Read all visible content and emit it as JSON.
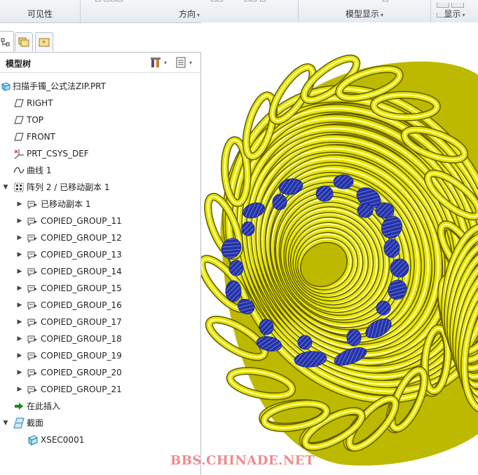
{
  "ribbon": {
    "groups": [
      {
        "label": "可见性"
      },
      {
        "label": "方向"
      },
      {
        "label": "模型显示"
      },
      {
        "label": "显示"
      }
    ],
    "caret": "▾"
  },
  "tree": {
    "title": "模型树",
    "root": "扫描手镯_公式法ZIP.PRT",
    "items": [
      {
        "label": "RIGHT",
        "icon": "datum-plane-icon"
      },
      {
        "label": "TOP",
        "icon": "datum-plane-icon"
      },
      {
        "label": "FRONT",
        "icon": "datum-plane-icon"
      },
      {
        "label": "PRT_CSYS_DEF",
        "icon": "coordinate-system-icon"
      },
      {
        "label": "曲线 1",
        "icon": "curve-icon"
      },
      {
        "label": "阵列 2 / 已移动副本 1",
        "icon": "pattern-icon"
      },
      {
        "label": "已移动副本 1",
        "icon": "group-icon"
      },
      {
        "label": "COPIED_GROUP_11",
        "icon": "group-icon"
      },
      {
        "label": "COPIED_GROUP_12",
        "icon": "group-icon"
      },
      {
        "label": "COPIED_GROUP_13",
        "icon": "group-icon"
      },
      {
        "label": "COPIED_GROUP_14",
        "icon": "group-icon"
      },
      {
        "label": "COPIED_GROUP_15",
        "icon": "group-icon"
      },
      {
        "label": "COPIED_GROUP_16",
        "icon": "group-icon"
      },
      {
        "label": "COPIED_GROUP_17",
        "icon": "group-icon"
      },
      {
        "label": "COPIED_GROUP_18",
        "icon": "group-icon"
      },
      {
        "label": "COPIED_GROUP_19",
        "icon": "group-icon"
      },
      {
        "label": "COPIED_GROUP_20",
        "icon": "group-icon"
      },
      {
        "label": "COPIED_GROUP_21",
        "icon": "group-icon"
      },
      {
        "label": "在此插入",
        "icon": "insert-here-icon"
      },
      {
        "label": "截面",
        "icon": "cross-section-icon"
      },
      {
        "label": "XSEC0001",
        "icon": "xsec-icon"
      }
    ]
  },
  "watermark": "BBS.CHINADE.NET",
  "colors": {
    "model": "#e6e600",
    "section": "#1a2aa0",
    "watermark": "#f08a8a",
    "insert_arrow": "#1a8a1a"
  }
}
